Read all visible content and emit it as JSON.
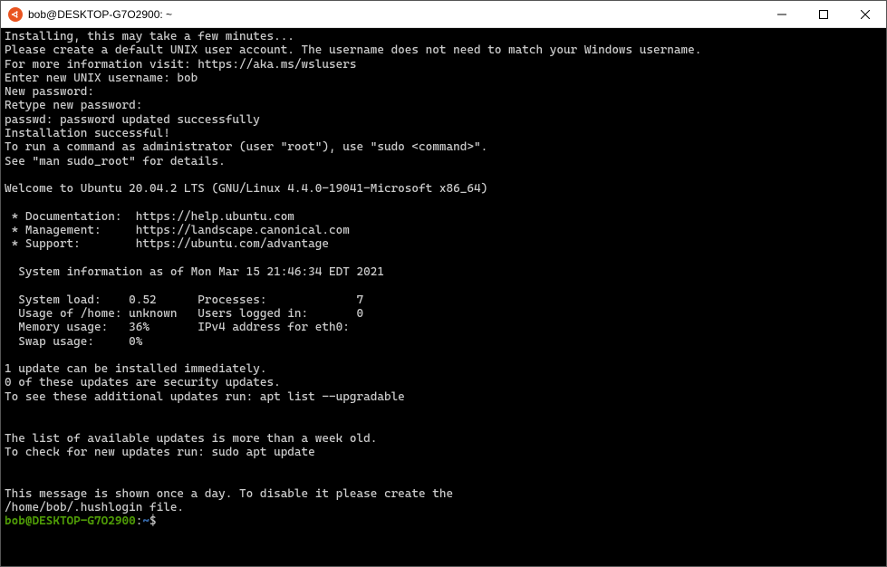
{
  "titlebar": {
    "title": "bob@DESKTOP-G7O2900: ~"
  },
  "terminal": {
    "lines": [
      "Installing, this may take a few minutes...",
      "Please create a default UNIX user account. The username does not need to match your Windows username.",
      "For more information visit: https://aka.ms/wslusers",
      "Enter new UNIX username: bob",
      "New password:",
      "Retype new password:",
      "passwd: password updated successfully",
      "Installation successful!",
      "To run a command as administrator (user \"root\"), use \"sudo <command>\".",
      "See \"man sudo_root\" for details.",
      "",
      "Welcome to Ubuntu 20.04.2 LTS (GNU/Linux 4.4.0-19041-Microsoft x86_64)",
      "",
      " * Documentation:  https://help.ubuntu.com",
      " * Management:     https://landscape.canonical.com",
      " * Support:        https://ubuntu.com/advantage",
      "",
      "  System information as of Mon Mar 15 21:46:34 EDT 2021",
      "",
      "  System load:    0.52      Processes:             7",
      "  Usage of /home: unknown   Users logged in:       0",
      "  Memory usage:   36%       IPv4 address for eth0:",
      "  Swap usage:     0%",
      "",
      "1 update can be installed immediately.",
      "0 of these updates are security updates.",
      "To see these additional updates run: apt list --upgradable",
      "",
      "",
      "The list of available updates is more than a week old.",
      "To check for new updates run: sudo apt update",
      "",
      "",
      "This message is shown once a day. To disable it please create the",
      "/home/bob/.hushlogin file."
    ],
    "prompt": {
      "user_host": "bob@DESKTOP-G7O2900",
      "path": "~",
      "symbol": "$"
    }
  }
}
